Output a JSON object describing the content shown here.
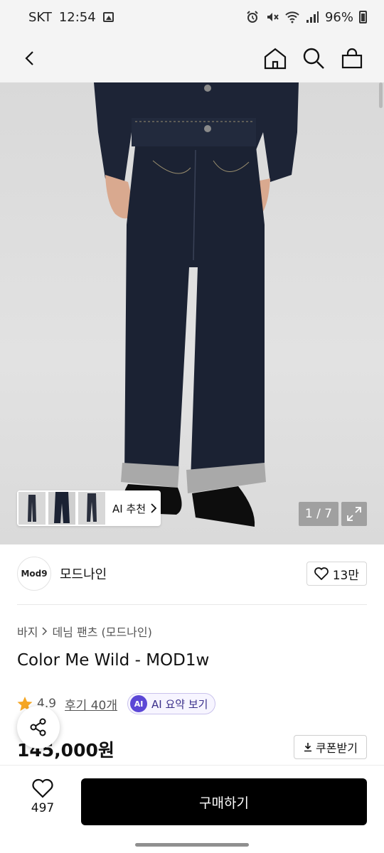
{
  "status_bar": {
    "carrier": "SKT",
    "time": "12:54",
    "battery": "96%"
  },
  "header": {
    "icons": [
      "back-icon",
      "home-icon",
      "search-icon",
      "shopping-bag-icon"
    ]
  },
  "gallery": {
    "ai_recommend_label": "AI 추천",
    "counter": "1 / 7"
  },
  "brand": {
    "logo_text": "Mod9",
    "name": "모드나인",
    "likes": "13만"
  },
  "product": {
    "breadcrumb": [
      "바지",
      "데님 팬츠 (모드나인)"
    ],
    "title": "Color Me Wild - MOD1w",
    "rating": "4.9",
    "review_link": "후기 40개",
    "ai_summary_badge": "AI",
    "ai_summary_label": "AI 요약 보기",
    "price": "145,000원",
    "coupon_label": "쿠폰받기"
  },
  "bottom_bar": {
    "wish_count": "497",
    "buy_label": "구매하기"
  },
  "colors": {
    "accent_star": "#f5a623",
    "ai_purple": "#5b47d6",
    "buy_button": "#000000"
  }
}
